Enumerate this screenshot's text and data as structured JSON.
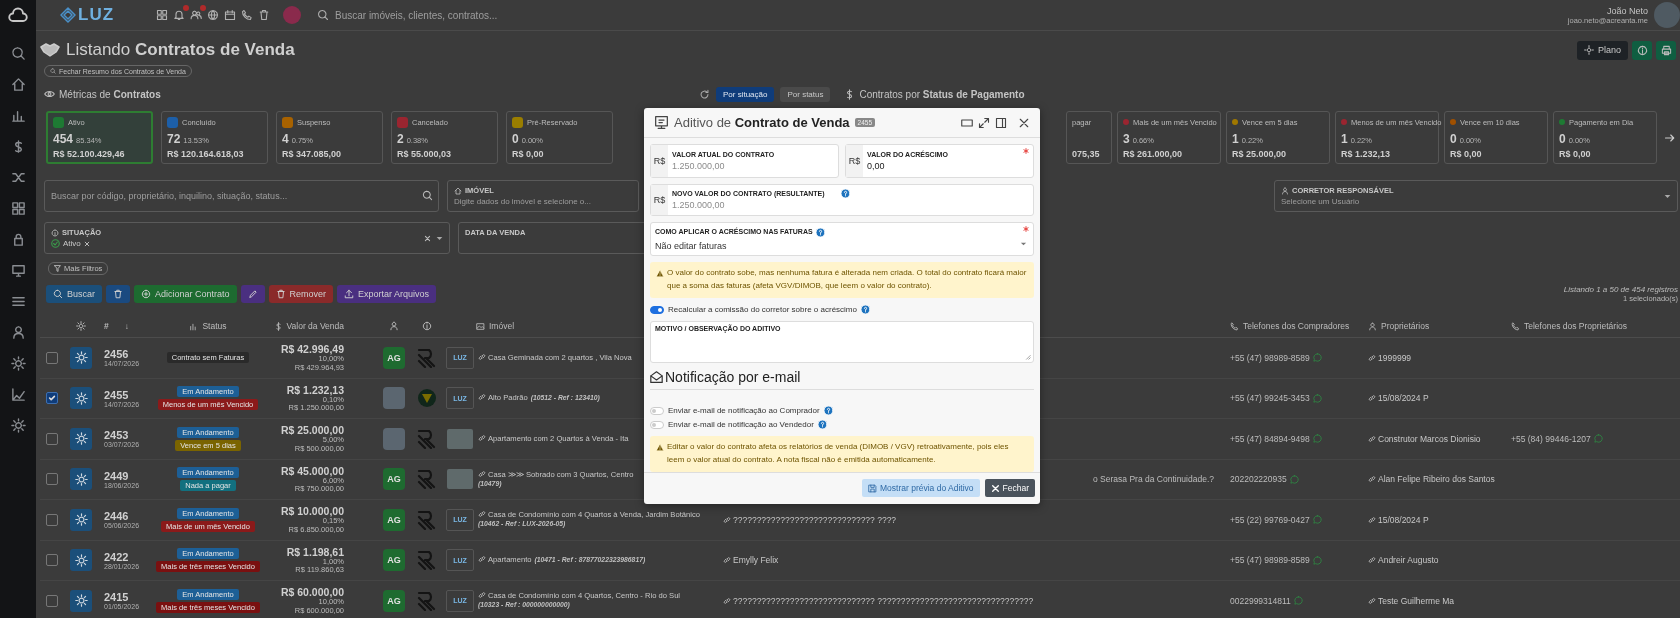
{
  "topbar": {
    "logo": "LUZ",
    "search_placeholder": "Buscar imóveis, clientes, contratos...",
    "user_name": "João Neto",
    "user_email": "joao.neto@acreanta.me"
  },
  "page": {
    "title": "Listando **Contratos de Venda**",
    "summary_button": "Fechar Resumo dos Contratos de Venda",
    "plan_button": "Plano"
  },
  "metrics": {
    "title": "Métricas de **Contratos**",
    "view_tabs": [
      {
        "label": "Por situação",
        "selected": true
      },
      {
        "label": "Por status",
        "selected": false
      }
    ],
    "payment_title": "Contratos por **Status de Pagamento**",
    "status_cards": [
      {
        "label": "Ativo",
        "count": "454",
        "percent": "85.34%",
        "amount": "R$ 52.100.429,46",
        "color": "#1e7a33",
        "selected": true
      },
      {
        "label": "Concluído",
        "count": "72",
        "percent": "13.53%",
        "amount": "R$ 120.164.618,03",
        "color": "#1d5fa8",
        "selected": false
      },
      {
        "label": "Suspenso",
        "count": "4",
        "percent": "0.75%",
        "amount": "R$ 347.085,00",
        "color": "#a86200",
        "selected": false
      },
      {
        "label": "Cancelado",
        "count": "2",
        "percent": "0.38%",
        "amount": "R$ 55.000,03",
        "color": "#9a2530",
        "selected": false
      },
      {
        "label": "Pré-Reservado",
        "count": "0",
        "percent": "0.00%",
        "amount": "R$ 0,00",
        "color": "#9a7e00",
        "selected": false
      }
    ],
    "payment_cards": [
      {
        "kind": "cut",
        "label": "pagar",
        "amount": "075,35"
      },
      {
        "kind": "full",
        "label": "Mais de um mês Vencido",
        "count": "3",
        "percent": "0.66%",
        "amount": "R$ 261.000,00",
        "color": "#9a2530"
      },
      {
        "kind": "full",
        "label": "Vence em 5 dias",
        "count": "1",
        "percent": "0.22%",
        "amount": "R$ 25.000,00",
        "color": "#a07800"
      },
      {
        "kind": "full",
        "label": "Menos de um mês Vencido",
        "count": "1",
        "percent": "0.22%",
        "amount": "R$ 1.232,13",
        "color": "#9a2530"
      },
      {
        "kind": "full",
        "label": "Vence em 10 dias",
        "count": "0",
        "percent": "0.00%",
        "amount": "R$ 0,00",
        "color": "#a05000"
      },
      {
        "kind": "full",
        "label": "Pagamento em Dia",
        "count": "0",
        "percent": "0.00%",
        "amount": "R$ 0,00",
        "color": "#1e7a33"
      }
    ]
  },
  "filters": {
    "search_placeholder": "Buscar por código, proprietário, inquilino, situação, status...",
    "property": {
      "label": "IMÓVEL",
      "placeholder": "Digite dados do imóvel e selecione o..."
    },
    "broker": {
      "label": "CORRETOR RESPONSÁVEL",
      "placeholder": "Selecione um Usuário"
    },
    "situation": {
      "label": "SITUAÇÃO",
      "tags": [
        "Ativo"
      ]
    },
    "sale_date": {
      "label": "DATA DA VENDA"
    },
    "more_filters": "Mais Filtros"
  },
  "actions": [
    {
      "kind": "search",
      "label": "Buscar"
    },
    {
      "kind": "delete"
    },
    {
      "kind": "add",
      "label": "Adicionar Contrato"
    },
    {
      "kind": "edit"
    },
    {
      "kind": "remove",
      "label": "Remover"
    },
    {
      "kind": "export",
      "label": "Exportar Arquivos"
    }
  ],
  "listing": {
    "summary": "Listando 1 a 50 de 454 registros",
    "selected": "1 selecionado(s)"
  },
  "table": {
    "header": {
      "number": "#",
      "sort": "↓",
      "status": "Status",
      "value": "Valor da Venda",
      "property": "Imóvel",
      "buyer_phones": "Telefones dos Compradores",
      "owners": "Proprietários",
      "owner_phones": "Telefones dos Proprietários"
    },
    "rows": [
      {
        "checked": false,
        "number": "2456",
        "date": "14/07/2026",
        "badges": [
          {
            "label": "Contrato sem Faturas",
            "color": "#2a2a2a"
          }
        ],
        "value": "R$ 42.996,49",
        "percent": "10,00%",
        "total": "R$ 429.964,93",
        "avatar": {
          "kind": "initials",
          "text": "AG"
        },
        "agency": {
          "kind": "stripes"
        },
        "thumb": {
          "kind": "logo",
          "label": "LUZ"
        },
        "property": "Casa Geminada com 2 quartos , Vila Nova",
        "buyer_phone": "+55 (47) 98989-8589",
        "owner": "1999999"
      },
      {
        "checked": true,
        "number": "2455",
        "date": "14/07/2026",
        "badges": [
          {
            "label": "Em Andamento",
            "color": "#1d5f96"
          },
          {
            "label": "Menos de um mês Vencido",
            "color": "#8b1a1a"
          }
        ],
        "value": "R$ 1.232,13",
        "percent": "0,10%",
        "total": "R$ 1.250.000,00",
        "avatar": {
          "kind": "photo"
        },
        "agency": {
          "kind": "round"
        },
        "thumb": {
          "kind": "logo",
          "label": "LUZ"
        },
        "property": "Alto Padrão",
        "ref": "(10512 - Ref : 123410)",
        "buyer_phone": "+55 (47) 99245-3453",
        "owner": "15/08/2024 P"
      },
      {
        "checked": false,
        "number": "2453",
        "date": "03/07/2026",
        "badges": [
          {
            "label": "Em Andamento",
            "color": "#1d5f96"
          },
          {
            "label": "Vence em 5 dias",
            "color": "#7a6400"
          }
        ],
        "value": "R$ 25.000,00",
        "percent": "5,00%",
        "total": "R$ 500.000,00",
        "avatar": {
          "kind": "photo"
        },
        "agency": {
          "kind": "stripes"
        },
        "thumb": {
          "kind": "photo"
        },
        "property": "Apartamento com 2 Quartos à Venda - Ita",
        "buyer_phone": "+55 (47) 84894-9498",
        "owner": "Construtor Marcos Dionisio",
        "owner_phone": "+55 (84) 99446-1207"
      },
      {
        "checked": false,
        "number": "2449",
        "date": "18/06/2026",
        "badges": [
          {
            "label": "Em Andamento",
            "color": "#1d5f96"
          },
          {
            "label": "Nada a pagar",
            "color": "#12707f"
          }
        ],
        "value": "R$ 45.000,00",
        "percent": "6,00%",
        "total": "R$ 750.000,00",
        "avatar": {
          "kind": "initials",
          "text": "AG"
        },
        "agency": {
          "kind": "stripes"
        },
        "thumb": {
          "kind": "photo"
        },
        "property": "Casa ≫≫ Sobrado com 3 Quartos, Centro",
        "ref": "(10479)",
        "note": {
          "kind": "tail",
          "text": "o Serasa Pra da Continuidade.?"
        },
        "buyer_phone": "202202220935",
        "owner": "Alan Felipe Ribeiro dos Santos"
      },
      {
        "checked": false,
        "number": "2446",
        "date": "05/06/2026",
        "badges": [
          {
            "label": "Em Andamento",
            "color": "#1d5f96"
          },
          {
            "label": "Mais de um mês Vencido",
            "color": "#8b1a1a"
          }
        ],
        "value": "R$ 10.000,00",
        "percent": "0,15%",
        "total": "R$ 6.850.000,00",
        "avatar": {
          "kind": "initials",
          "text": "AG"
        },
        "agency": {
          "kind": "stripes"
        },
        "thumb": {
          "kind": "logo",
          "label": "LUZ"
        },
        "property": "Casa de Condomínio com 4 Quartos à Venda, Jardim Botânico",
        "ref": "(10462 - Ref : LUX-2026-05)",
        "note": {
          "kind": "link",
          "text": "?????????????????????????????? ????"
        },
        "buyer_phone": "+55 (22) 99769-0427",
        "owner": "15/08/2024 P"
      },
      {
        "checked": false,
        "number": "2422",
        "date": "28/01/2026",
        "badges": [
          {
            "label": "Em Andamento",
            "color": "#1d5f96"
          },
          {
            "label": "Mais de três meses Vencido",
            "color": "#7a1010"
          }
        ],
        "value": "R$ 1.198,61",
        "percent": "1,00%",
        "total": "R$ 119.860,63",
        "avatar": {
          "kind": "initials",
          "text": "AG"
        },
        "agency": {
          "kind": "stripes"
        },
        "thumb": {
          "kind": "logo",
          "label": "LUZ"
        },
        "property": "Apartamento",
        "ref": "(10471 - Ref : 87877022323986817)",
        "note": {
          "kind": "link",
          "text": "Emylly Felix"
        },
        "buyer_phone": "+55 (47) 98989-8589",
        "owner": "Andreir Augusto"
      },
      {
        "checked": false,
        "number": "2415",
        "date": "01/05/2026",
        "badges": [
          {
            "label": "Em Andamento",
            "color": "#1d5f96"
          },
          {
            "label": "Mais de três meses Vencido",
            "color": "#7a1010"
          }
        ],
        "value": "R$ 60.000,00",
        "percent": "10,00%",
        "total": "R$ 600.000,00",
        "avatar": {
          "kind": "initials",
          "text": "AG"
        },
        "agency": {
          "kind": "stripes"
        },
        "thumb": {
          "kind": "logo",
          "label": "LUZ"
        },
        "property": "Casa de Condomínio com 4 Quartos, Centro - Rio do Sul",
        "ref": "(10323 - Ref : 000000000000)",
        "note": {
          "kind": "link",
          "text": "?????????????????????????????? ?????????????????????????????????"
        },
        "buyer_phone": "0022999314811",
        "owner": "Teste Guilherme Ma"
      }
    ]
  },
  "modal": {
    "title": "Aditivo de **Contrato de Venda**",
    "badge": "2455",
    "current_value": {
      "label": "VALOR ATUAL DO CONTRATO",
      "prefix": "R$",
      "value": "1.250.000,00",
      "disabled": true,
      "required": false
    },
    "increase": {
      "label": "VALOR DO ACRÉSCIMO",
      "prefix": "R$",
      "value": "0,00",
      "disabled": false,
      "required": true
    },
    "new_value": {
      "label": "NOVO VALOR DO CONTRATO (RESULTANTE)",
      "prefix": "R$",
      "value": "1.250.000,00",
      "disabled": true,
      "required": false
    },
    "invoice_mode": {
      "label": "COMO APLICAR O ACRÉSCIMO NAS FATURAS",
      "value": "Não editar faturas",
      "required": true
    },
    "invoice_alert": "O valor do contrato sobe, mas nenhuma fatura é alterada nem criada. O total do contrato ficará maior que a soma das faturas (afeta VGV/DIMOB, que leem o valor do contrato).",
    "commission_toggle": {
      "label": "Recalcular a comissão do corretor sobre o acréscimo",
      "on": true
    },
    "notes": {
      "label": "MOTIVO / OBSERVAÇÃO DO ADITIVO"
    },
    "notification_title": "Notificação por e-mail",
    "notifications": [
      {
        "label": "Enviar e-mail de notificação ao Comprador",
        "on": false
      },
      {
        "label": "Enviar e-mail de notificação ao Vendedor",
        "on": false
      }
    ],
    "report_alert": "Editar o valor do contrato afeta os relatórios de venda (DIMOB / VGV) retroativamente, pois eles leem o valor atual do contrato. A nota fiscal não é emitida automaticamente.",
    "preview_button": {
      "label": "Mostrar prévia do Aditivo",
      "disabled": true
    },
    "close_button": "Fechar"
  }
}
